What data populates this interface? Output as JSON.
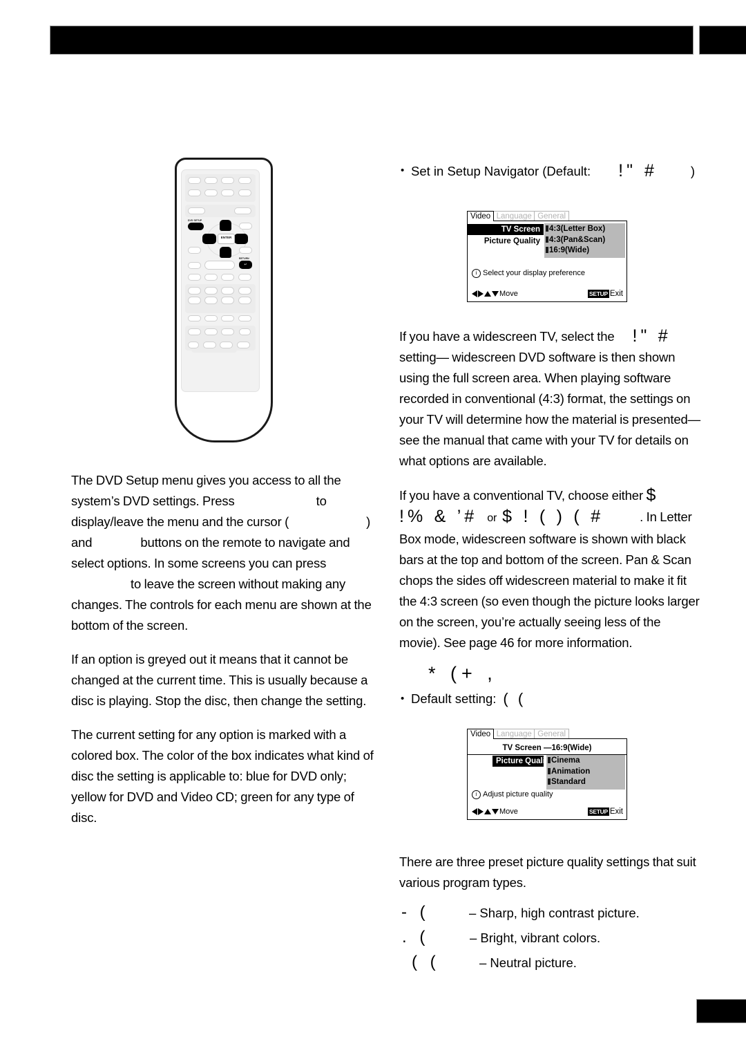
{
  "document": {
    "type": "dvd-player-owner-manual-page",
    "header": {
      "bar_color": "#000000"
    },
    "footer": {
      "bar_color": "#000000"
    }
  },
  "remote": {
    "name": "remote-control-illustration",
    "labels": {
      "dvd_setup": "DVD SETUP",
      "enter": "ENTER",
      "return": "RETURN",
      "return_glyph": "↵"
    }
  },
  "left_column": {
    "paragraphs": [
      {
        "id": "p-setup-menu",
        "segments": [
          {
            "type": "text",
            "value": "The DVD Setup menu gives you access to all the system’s DVD settings. Press"
          },
          {
            "type": "gap",
            "width": "s"
          },
          {
            "type": "text",
            "value": "to display/leave the menu and the cursor ("
          },
          {
            "type": "gap",
            "width": "m"
          },
          {
            "type": "text",
            "value": ") and"
          },
          {
            "type": "gap",
            "width": "l"
          },
          {
            "type": "text",
            "value": "buttons on the remote to navigate and select options. In some screens you can press"
          },
          {
            "type": "gap",
            "width": "xs"
          },
          {
            "type": "text",
            "value": "to leave the screen without making any changes. The controls for each menu are shown at the bottom of the screen."
          }
        ]
      },
      {
        "id": "p-greyed-out",
        "text": "If an option is greyed out it means that it cannot be changed at the current time. This is usually because a disc is playing. Stop the disc, then change the setting."
      },
      {
        "id": "p-colored-box",
        "text": "The current setting for any option is marked with a colored box. The color of the box indicates what kind of disc the setting is applicable to: blue for DVD only; yellow for DVD and Video CD; green for any type of disc."
      }
    ]
  },
  "right_column": {
    "bullet_setup_navigator": {
      "prefix": "Set in Setup Navigator (Default:",
      "garbled_value": "!\"  #",
      "suffix": ")"
    },
    "paragraph_widescreen": {
      "lead": "If you have a widescreen TV, select the",
      "garbled_value": "!\"  #",
      "rest": "setting— widescreen DVD software is then shown using the full screen area. When playing software recorded in conventional (4:3) format, the settings on your TV will determine how the material is presented— see the manual that came with your TV for details on what options are available."
    },
    "paragraph_conventional": {
      "lead": "If you have a conventional TV, choose either",
      "garbled_a": "$",
      "garbled_b": "!%     & ’#",
      "conjunction": "or",
      "garbled_c": "$   ! (  )   ( #",
      "rest": ". In Letter Box mode, widescreen software is shown with black bars at the top and bottom of the screen. Pan & Scan chops the sides off widescreen material to make it fit the 4:3 screen (so even though the picture looks larger on the screen, you’re actually seeing less of the movie). See page 46 for more information."
    },
    "section_picture_quality": {
      "garbled_heading": "* (+  ,",
      "bullet_default": {
        "prefix": "Default setting:",
        "garbled_value": "(  ("
      },
      "intro": "There are three preset picture quality settings that suit various program types.",
      "items": [
        {
          "garbled_term": "-   (",
          "indent": "i1",
          "description": "– Sharp, high contrast picture."
        },
        {
          "garbled_term": ".  (",
          "indent": "i2",
          "description": "– Bright, vibrant colors."
        },
        {
          "garbled_term": "(  (",
          "indent": "i3",
          "description": "– Neutral picture."
        }
      ]
    }
  },
  "osd_screens": [
    {
      "id": "osd-tv-screen",
      "tabs": [
        {
          "label": "Video",
          "state": "active"
        },
        {
          "label": "Language",
          "state": "dimmed"
        },
        {
          "label": "General",
          "state": "dimmed"
        }
      ],
      "rows": [
        {
          "label": "TV Screen",
          "style": "highlighted"
        },
        {
          "label": "Picture Quality",
          "style": "plain"
        }
      ],
      "options": [
        "4:3(Letter Box)",
        "4:3(Pan&Scan)",
        "16:9(Wide)"
      ],
      "tip": "Select your display preference",
      "tip_icon": "i",
      "footer": {
        "move_label": "Move",
        "setup_key": "SETUP",
        "exit_label": "Exit"
      }
    },
    {
      "id": "osd-picture-quality",
      "tabs": [
        {
          "label": "Video",
          "state": "active"
        },
        {
          "label": "Language",
          "state": "dimmed"
        },
        {
          "label": "General",
          "state": "dimmed"
        }
      ],
      "rows": [
        {
          "label": "TV Screen —16:9(Wide)",
          "style": "plain-centered"
        },
        {
          "label": "Picture Quality",
          "style": "highlighted"
        }
      ],
      "options": [
        "Cinema",
        "Animation",
        "Standard"
      ],
      "tip": "Adjust picture quality",
      "tip_icon": "i",
      "footer": {
        "move_label": "Move",
        "setup_key": "SETUP",
        "exit_label": "Exit"
      }
    }
  ]
}
